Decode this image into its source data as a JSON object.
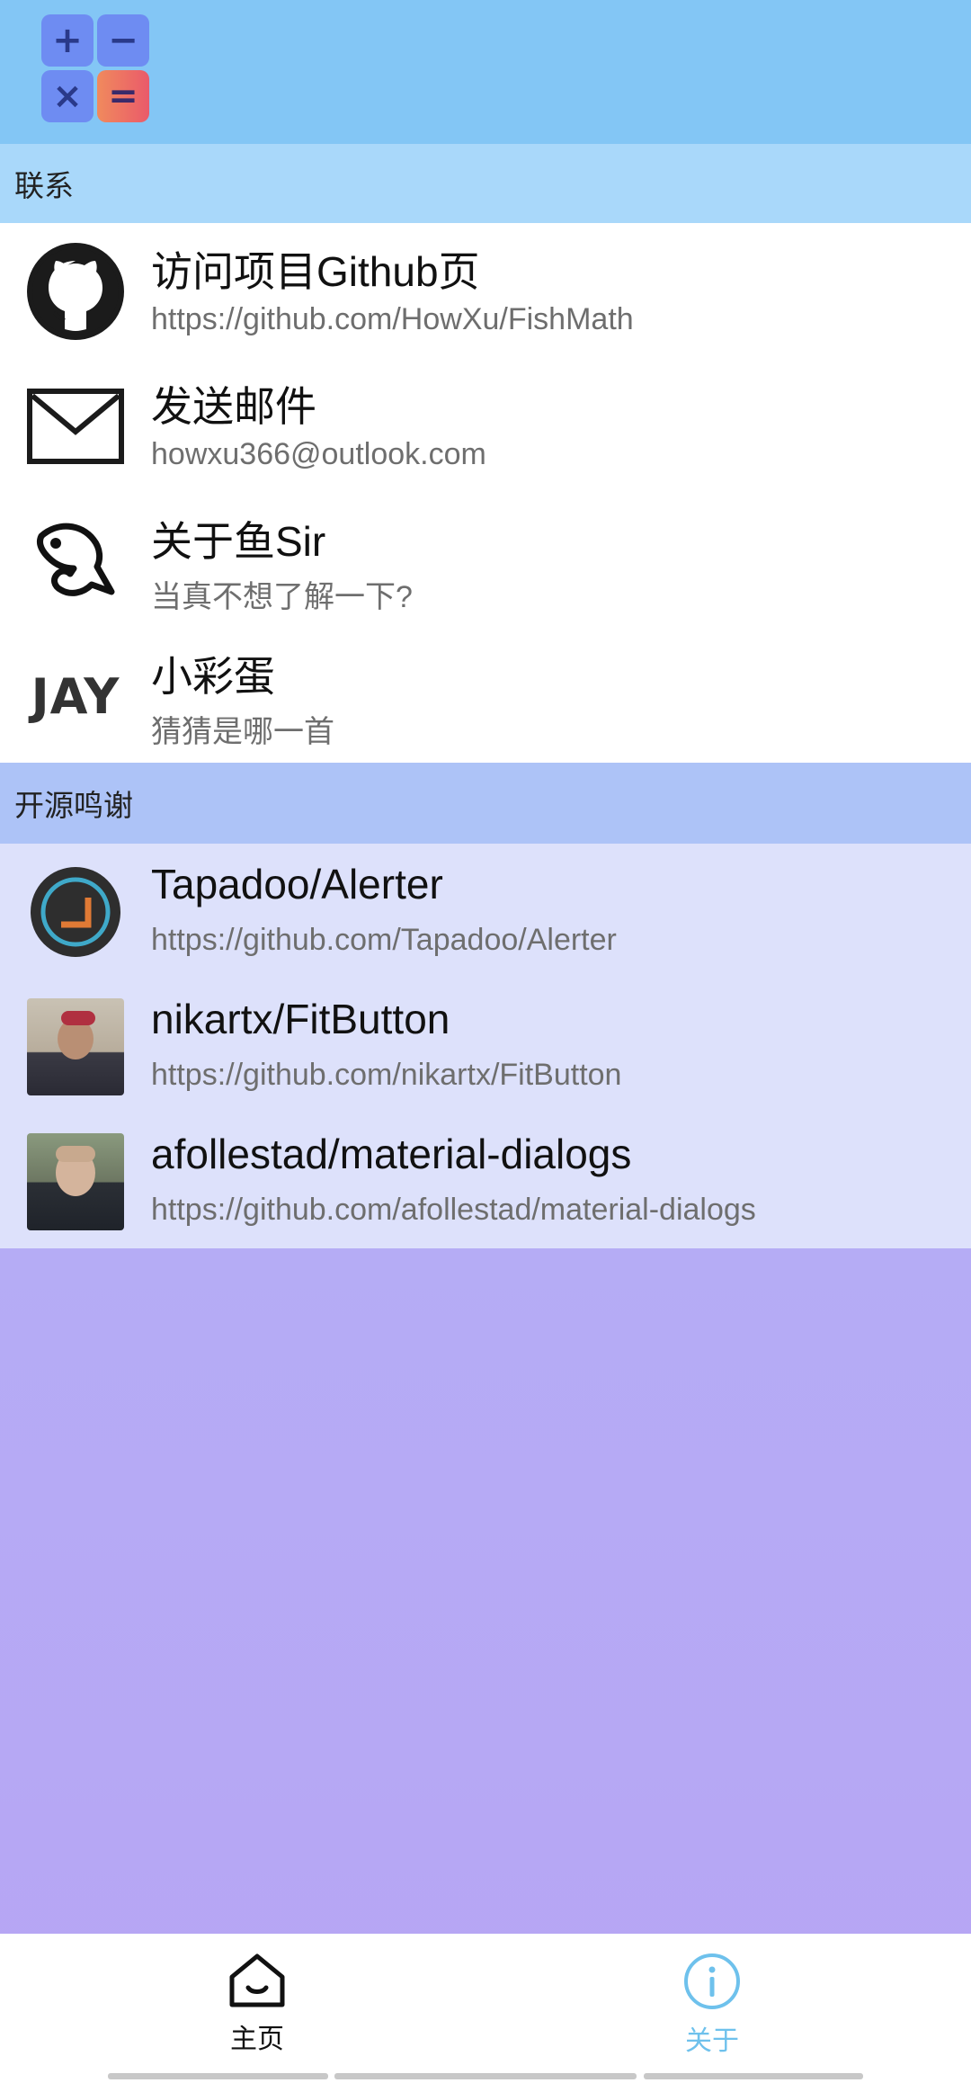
{
  "app": {
    "logo_cells": [
      "+",
      "−",
      "×",
      "="
    ]
  },
  "sections": {
    "contact": {
      "header": "联系",
      "items": [
        {
          "title": "访问项目Github页",
          "subtitle": "https://github.com/HowXu/FishMath",
          "icon": "github-icon"
        },
        {
          "title": "发送邮件",
          "subtitle": "howxu366@outlook.com",
          "icon": "mail-icon"
        },
        {
          "title": "关于鱼Sir",
          "subtitle": "当真不想了解一下?",
          "icon": "fish-icon"
        },
        {
          "title": "小彩蛋",
          "subtitle": "猜猜是哪一首",
          "icon_text": "JAY"
        }
      ]
    },
    "credits": {
      "header": "开源鸣谢",
      "items": [
        {
          "title": "Tapadoo/Alerter",
          "subtitle": "https://github.com/Tapadoo/Alerter",
          "icon": "alerter-logo"
        },
        {
          "title": "nikartx/FitButton",
          "subtitle": "https://github.com/nikartx/FitButton",
          "icon": "avatar-photo"
        },
        {
          "title": "afollestad/material-dialogs",
          "subtitle": "https://github.com/afollestad/material-dialogs",
          "icon": "avatar-photo"
        }
      ]
    }
  },
  "bottom_nav": {
    "tabs": [
      {
        "label": "主页",
        "icon": "home-icon",
        "active": false
      },
      {
        "label": "关于",
        "icon": "info-icon",
        "active": true
      }
    ],
    "active_color": "#6ec1ec",
    "inactive_color": "#111111"
  },
  "colors": {
    "topbar": "#83c6f5",
    "contact_header": "#a9d8fa",
    "credits_header": "#adc3f7",
    "credits_list": "#dde1fb"
  }
}
